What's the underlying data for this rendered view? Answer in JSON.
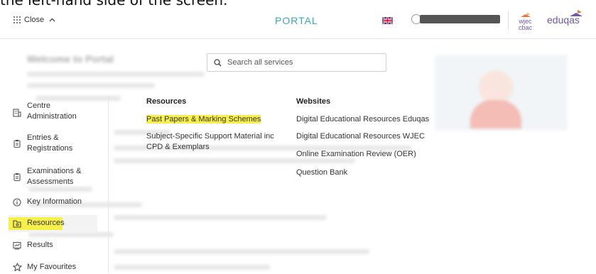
{
  "caption": "the left-hand side of the screen.",
  "header": {
    "close_label": "Close",
    "portal_title": "PORTAL",
    "logo_wjec": "wjec",
    "logo_cbac": "cbac",
    "logo_eduqas": "eduqas",
    "brand_color": "#6b57a5",
    "portal_color": "#3aa6b9"
  },
  "search": {
    "placeholder": "Search all services"
  },
  "sidebar": {
    "items": [
      {
        "label1": "Centre",
        "label2": "Administration",
        "icon": "building-icon"
      },
      {
        "label1": "Entries &",
        "label2": "Registrations",
        "icon": "clipboard-icon"
      },
      {
        "label1": "Examinations &",
        "label2": "Assessments",
        "icon": "clipboard-icon"
      },
      {
        "label1": "Key Information",
        "label2": "",
        "icon": "info-icon"
      },
      {
        "label1": "Resources",
        "label2": "",
        "icon": "folder-search-icon"
      },
      {
        "label1": "Results",
        "label2": "",
        "icon": "chart-icon"
      },
      {
        "label1": "My Favourites",
        "label2": "",
        "icon": "star-icon"
      }
    ]
  },
  "resources": {
    "heading": "Resources",
    "links": [
      "Past Papers & Marking Schemes",
      "Subject-Specific Support Material inc",
      "CPD & Exemplars"
    ]
  },
  "websites": {
    "heading": "Websites",
    "links": [
      "Digital Educational Resources Eduqas",
      "Digital Educational Resources WJEC",
      "Online Examination Review (OER)",
      "Question Bank"
    ]
  },
  "background": {
    "title": "Welcome to Portal"
  },
  "highlight_color": "#f8f04a"
}
